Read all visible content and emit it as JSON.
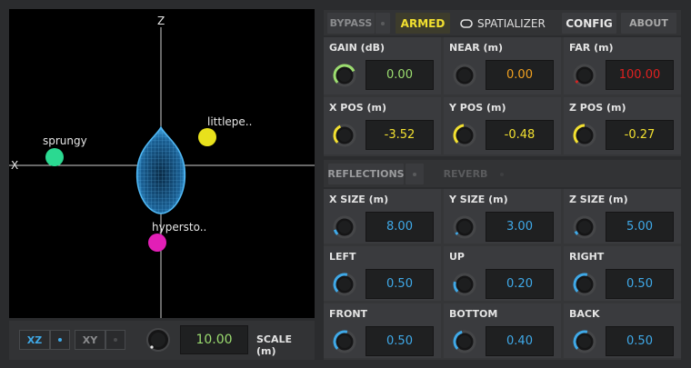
{
  "view": {
    "axis_z_label": "Z",
    "axis_x_label": "X",
    "objects": [
      {
        "name": "sprungy",
        "color": "#2bd991"
      },
      {
        "name": "littlepe..",
        "color": "#e8e11c"
      },
      {
        "name": "hypersto..",
        "color": "#e21fb6"
      }
    ]
  },
  "view_controls": {
    "xz_label": "XZ",
    "xy_label": "XY",
    "scale_value": "10.00",
    "scale_label": "SCALE (m)"
  },
  "top_bar": {
    "bypass_label": "BYPASS",
    "armed_label": "ARMED",
    "spatializer_label": "SPATIALIZER",
    "config_label": "CONFIG",
    "about_label": "ABOUT"
  },
  "params": {
    "gain": {
      "label": "GAIN (dB)",
      "value": "0.00",
      "color": "#9bdc6f"
    },
    "near": {
      "label": "NEAR (m)",
      "value": "0.00",
      "color": "#f0a020"
    },
    "far": {
      "label": "FAR (m)",
      "value": "100.00",
      "color": "#e02020"
    },
    "x_pos": {
      "label": "X POS (m)",
      "value": "-3.52",
      "color": "#f2e030"
    },
    "y_pos": {
      "label": "Y POS (m)",
      "value": "-0.48",
      "color": "#f2e030"
    },
    "z_pos": {
      "label": "Z POS (m)",
      "value": "-0.27",
      "color": "#f2e030"
    }
  },
  "reflections_bar": {
    "reflections_label": "REFLECTIONS",
    "reverb_label": "REVERB"
  },
  "room": {
    "x_size": {
      "label": "X SIZE (m)",
      "value": "8.00",
      "color": "#3fa9e8"
    },
    "y_size": {
      "label": "Y SIZE (m)",
      "value": "3.00",
      "color": "#3fa9e8"
    },
    "z_size": {
      "label": "Z SIZE (m)",
      "value": "5.00",
      "color": "#3fa9e8"
    },
    "left": {
      "label": "LEFT",
      "value": "0.50",
      "color": "#3fa9e8"
    },
    "up": {
      "label": "UP",
      "value": "0.20",
      "color": "#3fa9e8"
    },
    "right": {
      "label": "RIGHT",
      "value": "0.50",
      "color": "#3fa9e8"
    },
    "front": {
      "label": "FRONT",
      "value": "0.50",
      "color": "#3fa9e8"
    },
    "bottom": {
      "label": "BOTTOM",
      "value": "0.40",
      "color": "#3fa9e8"
    },
    "back": {
      "label": "BACK",
      "value": "0.50",
      "color": "#3fa9e8"
    }
  }
}
